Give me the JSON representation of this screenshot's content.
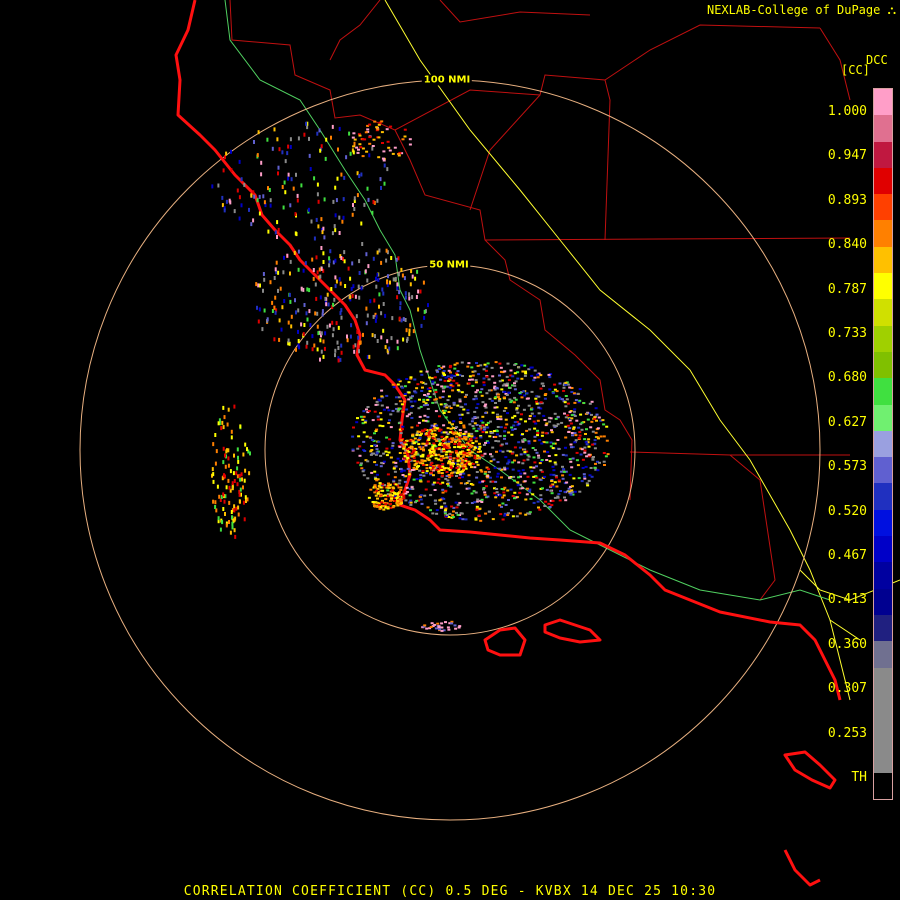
{
  "credit": "NEXLAB-College of DuPage",
  "credit_icon": "radar-logo-icon",
  "product_code": "DCC",
  "units_label": "[CC]",
  "caption": "CORRELATION COEFFICIENT (CC) 0.5 DEG - KVBX 14 DEC 25 10:30",
  "range_rings": [
    {
      "label": "100 NMI",
      "nmi": 100
    },
    {
      "label": "50 NMI",
      "nmi": 50
    }
  ],
  "colorbar": {
    "ticks": [
      "1.000",
      "0.947",
      "0.893",
      "0.840",
      "0.787",
      "0.733",
      "0.680",
      "0.627",
      "0.573",
      "0.520",
      "0.467",
      "0.413",
      "0.360",
      "0.307",
      "0.253",
      "TH"
    ],
    "colors": [
      "#ff9ec8",
      "#e07090",
      "#c01840",
      "#e00000",
      "#ff4000",
      "#ff8000",
      "#ffc000",
      "#ffff00",
      "#d0e000",
      "#a0d000",
      "#80c000",
      "#40e040",
      "#70f070",
      "#9aa0e0",
      "#6060d0",
      "#2030c0",
      "#0010e0",
      "#0000c8",
      "#0000a0",
      "#000090",
      "#202080",
      "#707090",
      "#8a8a8a",
      "#8a8a8a",
      "#8a8a8a",
      "#8a8a8a",
      "#000000"
    ]
  },
  "colors": {
    "background": "#000000",
    "coastline": "#ff1010",
    "county_lines": "#c01010",
    "highway": "#ffff30",
    "highway_green": "#50d060",
    "range_rings": "#e8b080",
    "text": "#ffff00"
  }
}
